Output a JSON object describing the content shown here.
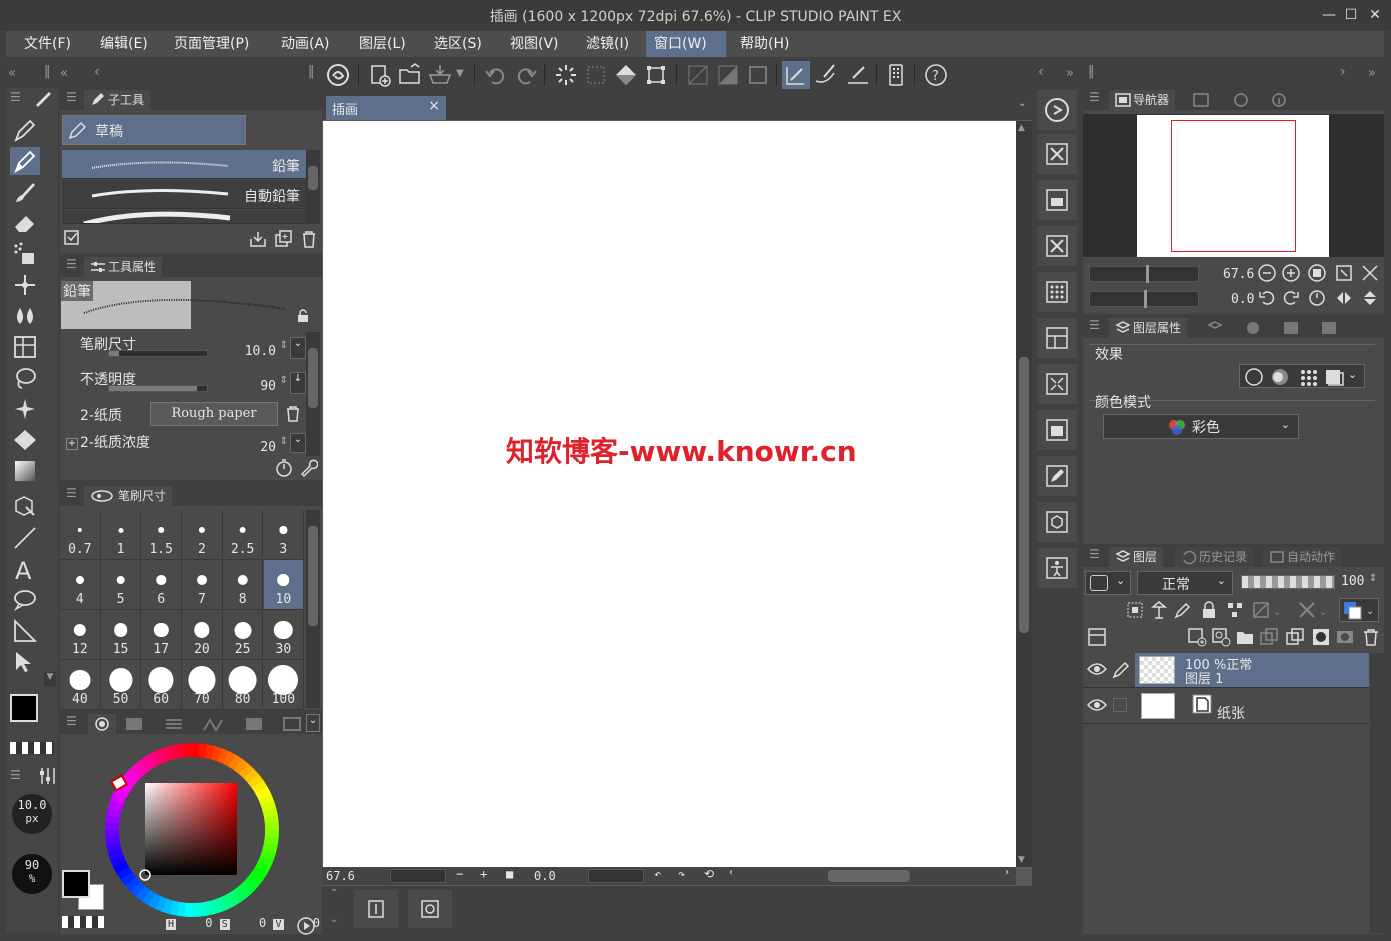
{
  "window": {
    "title": "插画 (1600 x 1200px 72dpi 67.6%)  - CLIP STUDIO PAINT EX",
    "controls": [
      "—",
      "☐",
      "✕"
    ]
  },
  "menu": [
    {
      "label": "文件(F)"
    },
    {
      "label": "编辑(E)"
    },
    {
      "label": "页面管理(P)"
    },
    {
      "label": "动画(A)"
    },
    {
      "label": "图层(L)"
    },
    {
      "label": "选区(S)"
    },
    {
      "label": "视图(V)"
    },
    {
      "label": "滤镜(I)"
    },
    {
      "label": "窗口(W)",
      "active": true
    },
    {
      "label": "帮助(H)"
    }
  ],
  "subtool_panel": {
    "tab": "子工具",
    "group": "草稿",
    "items": [
      {
        "label": "鉛筆",
        "selected": true
      },
      {
        "label": "自動鉛筆"
      }
    ]
  },
  "tool_property": {
    "tab": "工具属性",
    "preview_label": "鉛筆",
    "rows": [
      {
        "name": "笔刷尺寸",
        "value": "10.0",
        "fill": 0.1
      },
      {
        "name": "不透明度",
        "value": "90",
        "fill": 0.9
      },
      {
        "name": "2-纸质",
        "texture": "Rough paper"
      },
      {
        "name": "2-纸质浓度",
        "value": "20"
      }
    ]
  },
  "brush_size_panel": {
    "tab": "笔刷尺寸",
    "sizes": [
      "0.7",
      "1",
      "1.5",
      "2",
      "2.5",
      "3",
      "4",
      "5",
      "6",
      "7",
      "8",
      "10",
      "12",
      "15",
      "17",
      "20",
      "25",
      "30",
      "40",
      "50",
      "60",
      "70",
      "80",
      "100"
    ],
    "selected": "10"
  },
  "left_indicators": {
    "size": "10.0",
    "size_unit": "px",
    "opacity": "90",
    "opacity_unit": "%"
  },
  "color_wheel": {
    "h_label": "H",
    "h_value": "0",
    "s_label": "S",
    "s_value": "0",
    "v_label": "V",
    "v_value": "0",
    "main_color": "#000000",
    "sub_color": "#ffffff"
  },
  "canvas": {
    "tab": "插画",
    "watermark": "知软博客-www.knowr.cn",
    "zoom": "67.6",
    "angle": "0.0"
  },
  "navigator": {
    "tab": "导航器",
    "zoom": "67.6",
    "angle": "0.0"
  },
  "layer_property": {
    "tab": "图层属性",
    "effect_label": "效果",
    "color_mode_label": "颜色模式",
    "color_mode_value": "彩色"
  },
  "layer_panel": {
    "tabs": [
      "图层",
      "历史记录",
      "自动动作"
    ],
    "blend_mode": "正常",
    "opacity": "100",
    "layers": [
      {
        "line1": "100 %正常",
        "line2": "图层  1",
        "selected": true
      },
      {
        "line1": "",
        "line2": "纸张",
        "selected": false
      }
    ]
  },
  "colors": {
    "accent": "#5d6f8a",
    "panel": "#4a4a4a",
    "watermark": "#e0202a",
    "nav_frame": "#e02020"
  }
}
